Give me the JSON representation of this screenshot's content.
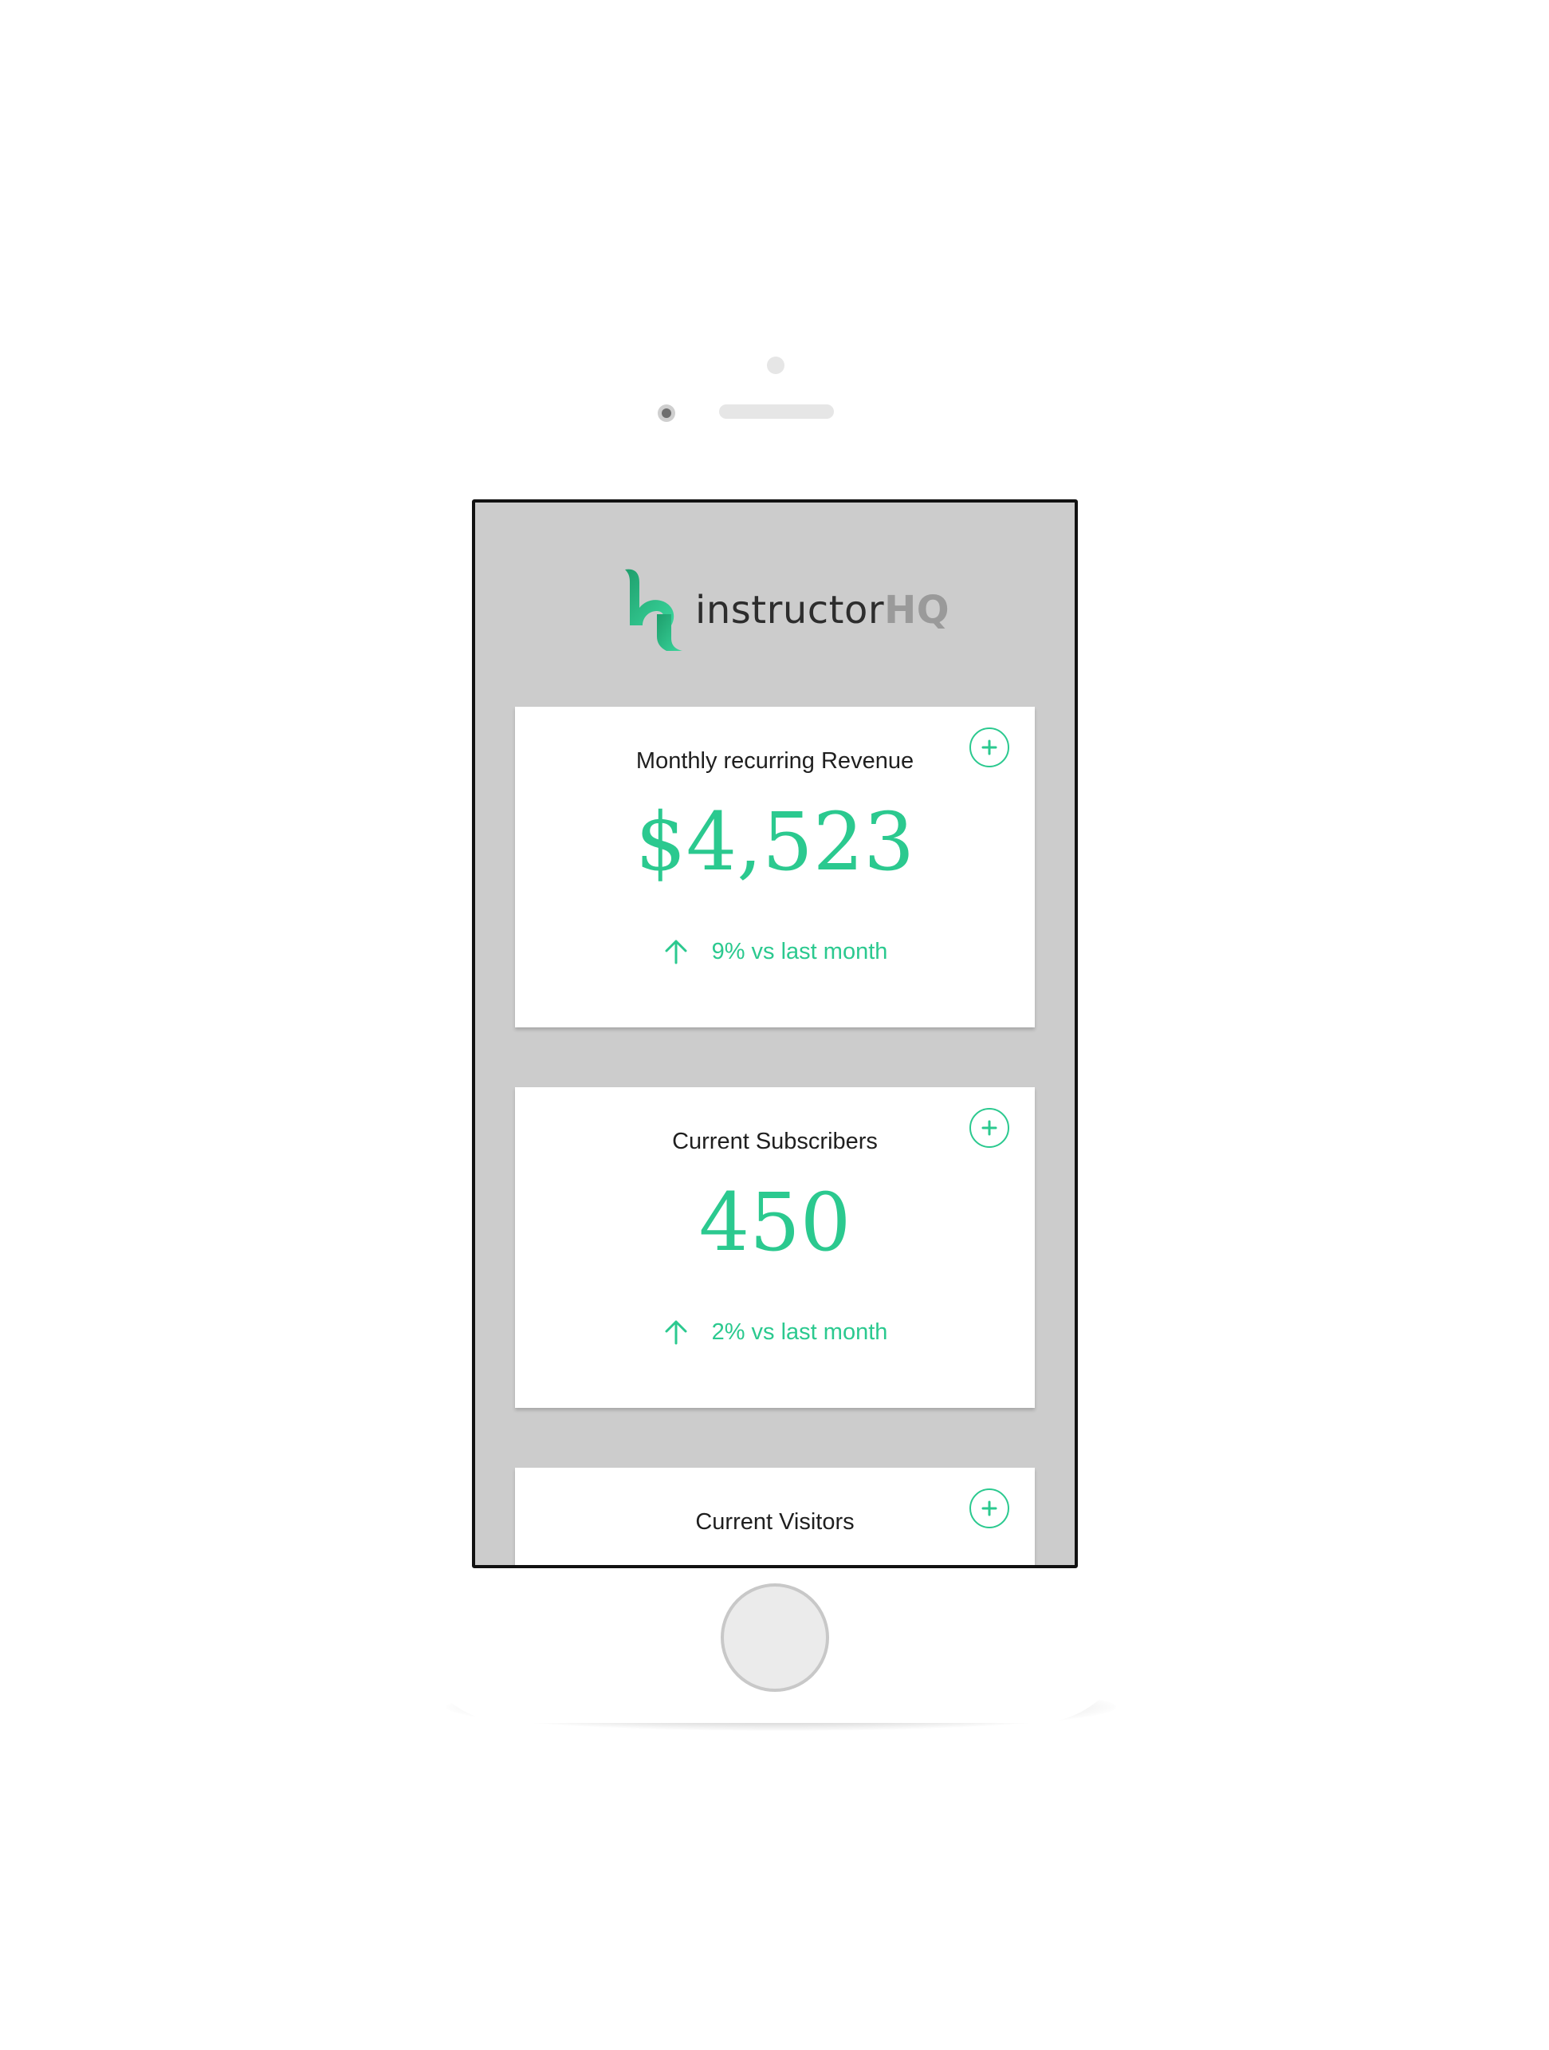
{
  "app": {
    "logo_text": "instructor",
    "logo_text_accent": "HQ"
  },
  "colors": {
    "accent": "#2bc98f",
    "screen_background": "#cccccc",
    "card_background": "#ffffff"
  },
  "cards": [
    {
      "title": "Monthly recurring Revenue",
      "value": "$4,523",
      "change": "9% vs last month",
      "trend_icon": "arrow-up-icon",
      "action_icon": "plus-icon"
    },
    {
      "title": "Current Subscribers",
      "value": "450",
      "change": "2% vs last month",
      "trend_icon": "arrow-up-icon",
      "action_icon": "plus-icon"
    },
    {
      "title": "Current Visitors",
      "action_icon": "plus-icon"
    }
  ]
}
